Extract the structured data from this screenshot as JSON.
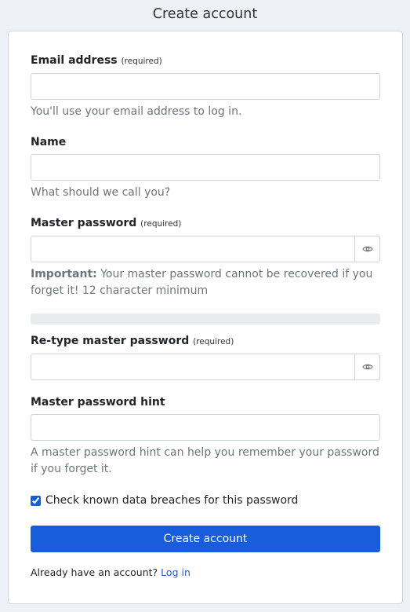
{
  "header": {
    "title": "Create account"
  },
  "form": {
    "email": {
      "label": "Email address",
      "required": "(required)",
      "value": "",
      "help": "You'll use your email address to log in."
    },
    "name": {
      "label": "Name",
      "value": "",
      "help": "What should we call you?"
    },
    "master_password": {
      "label": "Master password",
      "required": "(required)",
      "value": "",
      "help_strong": "Important:",
      "help": " Your master password cannot be recovered if you forget it! 12 character minimum",
      "toggle_icon": "eye-icon"
    },
    "strength_meter": {
      "level": 0
    },
    "retype_password": {
      "label": "Re-type master password",
      "required": "(required)",
      "value": "",
      "toggle_icon": "eye-icon"
    },
    "hint": {
      "label": "Master password hint",
      "value": "",
      "help": "A master password hint can help you remember your password if you forget it."
    },
    "breach_check": {
      "label": "Check known data breaches for this password",
      "checked": true
    },
    "submit_label": "Create account"
  },
  "footer": {
    "prompt": "Already have an account?",
    "login_link": "Log in"
  },
  "colors": {
    "primary": "#175ddc",
    "background": "#edf0f4"
  }
}
